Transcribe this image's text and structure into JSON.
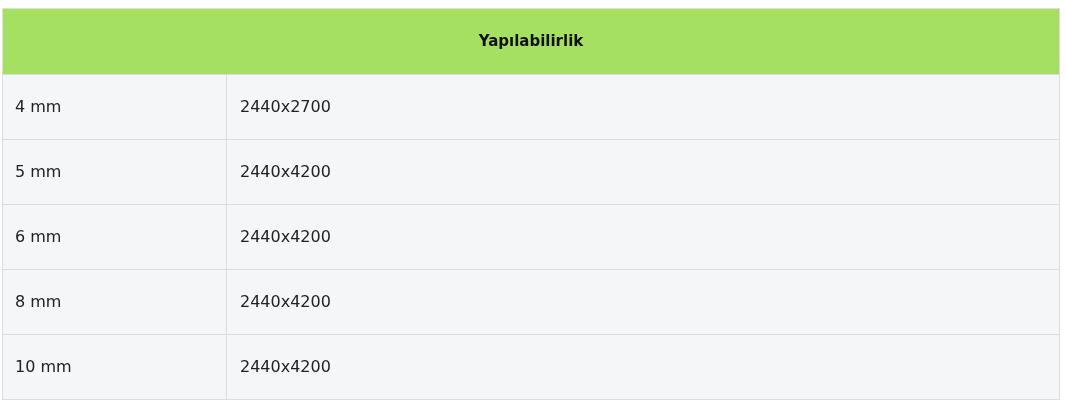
{
  "table": {
    "header": "Yapılabilirlik",
    "rows": [
      {
        "thickness": "4 mm",
        "size": "2440x2700"
      },
      {
        "thickness": "5 mm",
        "size": "2440x4200"
      },
      {
        "thickness": "6 mm",
        "size": "2440x4200"
      },
      {
        "thickness": "8 mm",
        "size": "2440x4200"
      },
      {
        "thickness": "10 mm",
        "size": "2440x4200"
      }
    ]
  }
}
